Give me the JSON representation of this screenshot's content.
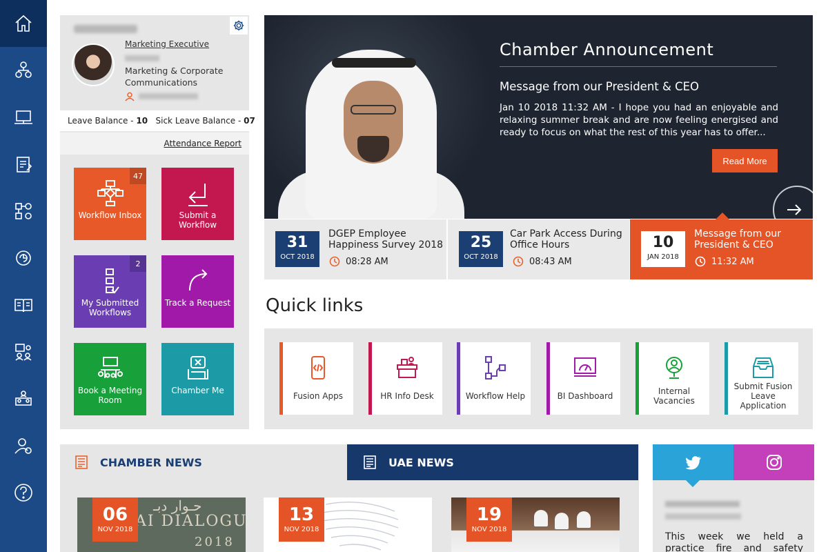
{
  "sidebar": {
    "items": [
      {
        "icon": "home-icon"
      },
      {
        "icon": "org-chart-icon"
      },
      {
        "icon": "laptop-icon"
      },
      {
        "icon": "clipboard-icon"
      },
      {
        "icon": "workflow-icon"
      },
      {
        "icon": "refresh-icon"
      },
      {
        "icon": "book-icon"
      },
      {
        "icon": "people-board-icon"
      },
      {
        "icon": "meeting-icon"
      },
      {
        "icon": "user-settings-icon"
      },
      {
        "icon": "help-icon"
      }
    ]
  },
  "profile": {
    "position": "Marketing Executive",
    "department": "Marketing & Corporate Communications",
    "leave_label": "Leave Balance - ",
    "leave_value": "10",
    "sick_label": "Sick Leave Balance - ",
    "sick_value": "07",
    "attendance_link": "Attendance Report"
  },
  "tiles": [
    {
      "label": "Workflow Inbox",
      "badge": "47",
      "color": "#e8592a",
      "icon": "workflow-icon"
    },
    {
      "label": "Submit a Workflow",
      "badge": "",
      "color": "#c3174f",
      "icon": "return-arrow-icon"
    },
    {
      "label": "My Submitted Workflows",
      "badge": "2",
      "color": "#6a3db3",
      "icon": "checklist-icon"
    },
    {
      "label": "Track a Request",
      "badge": "",
      "color": "#a019a8",
      "icon": "curved-arrow-icon"
    },
    {
      "label": "Book a Meeting Room",
      "badge": "",
      "color": "#18a03a",
      "icon": "meeting-table-icon"
    },
    {
      "label": "Chamber Me",
      "badge": "",
      "color": "#1c9aa5",
      "icon": "chamber-me-icon"
    }
  ],
  "announcement": {
    "title": "Chamber Announcement",
    "subtitle": "Message from our President & CEO",
    "body": "Jan 10 2018 11:32 AM - I hope you had an enjoyable and relaxing summer break and are now feeling energised and ready to focus on what the rest of this year has to offer...",
    "button": "Read More"
  },
  "events": [
    {
      "day": "31",
      "month": "OCT 2018",
      "title": "DGEP Employee Happiness Survey 2018",
      "time": "08:28 AM",
      "active": false
    },
    {
      "day": "25",
      "month": "OCT 2018",
      "title": "Car Park Access During Office Hours",
      "time": "08:43 AM",
      "active": false
    },
    {
      "day": "10",
      "month": "JAN 2018",
      "title": "Message from our President & CEO",
      "time": "11:32 AM",
      "active": true
    }
  ],
  "quick_links": {
    "heading": "Quick links",
    "items": [
      {
        "label": "Fusion Apps",
        "color": "#e8592a",
        "icon": "mobile-code-icon"
      },
      {
        "label": "HR Info Desk",
        "color": "#c3174f",
        "icon": "info-desk-icon"
      },
      {
        "label": "Workflow Help",
        "color": "#6a3db3",
        "icon": "workflow-help-icon"
      },
      {
        "label": "BI Dashboard",
        "color": "#a019a8",
        "icon": "dashboard-icon"
      },
      {
        "label": "Internal Vacancies",
        "color": "#18a03a",
        "icon": "vacancy-icon"
      },
      {
        "label": "Submit Fusion Leave Application",
        "color": "#1c9aa5",
        "icon": "inbox-tray-icon"
      }
    ]
  },
  "news": {
    "chamber_tab": "CHAMBER NEWS",
    "uae_tab": "UAE NEWS",
    "cards": [
      {
        "day": "06",
        "month": "NOV 2018",
        "image_text": "AI DIALOGUE",
        "image_year": "2018"
      },
      {
        "day": "13",
        "month": "NOV 2018"
      },
      {
        "day": "19",
        "month": "NOV 2018"
      }
    ]
  },
  "social": {
    "tweet": "This week we held a practice fire and safety evacuation"
  }
}
